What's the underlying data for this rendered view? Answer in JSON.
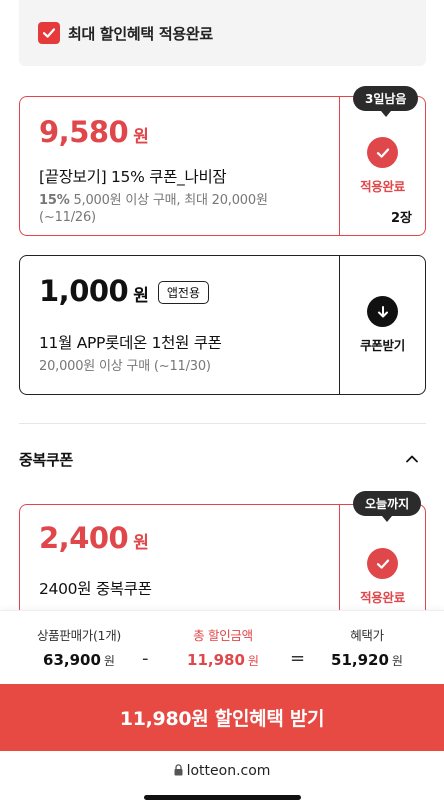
{
  "banner": {
    "text": "최대 할인혜택 적용완료"
  },
  "coupons": [
    {
      "amount": "9,580",
      "unit": "원",
      "name": "[끝장보기] 15% 쿠폰_나비잠",
      "desc_bold": "15%",
      "desc_line1": " 5,000원 이상 구매, 최대 20,000원",
      "desc_line2": "(~11/26)",
      "action_label": "적용완료",
      "count": "2장",
      "tooltip": "3일남음",
      "status": "applied"
    },
    {
      "amount": "1,000",
      "unit": "원",
      "badge": "앱전용",
      "name": "11월 APP롯데온 1천원 쿠폰",
      "desc_line1": "20,000원 이상 구매  (~11/30)",
      "action_label": "쿠폰받기",
      "status": "download"
    }
  ],
  "stack_section": {
    "title": "중복쿠폰"
  },
  "stack_coupon": {
    "amount": "2,400",
    "unit": "원",
    "name": "2400원 중복쿠폰",
    "action_label": "적용완료",
    "tooltip": "오늘까지",
    "status": "applied"
  },
  "summary": {
    "price_label": "상품판매가(1개)",
    "price_value": "63,900",
    "discount_label": "총 할인금액",
    "discount_value": "11,980",
    "benefit_label": "혜택가",
    "benefit_value": "51,920",
    "unit": "원",
    "minus": "-",
    "equals": "="
  },
  "cta": {
    "label": "11,980원 할인혜택 받기"
  },
  "browser": {
    "url": "lotteon.com"
  },
  "colors": {
    "accent": "#e0474b",
    "cta": "#e64a42"
  }
}
